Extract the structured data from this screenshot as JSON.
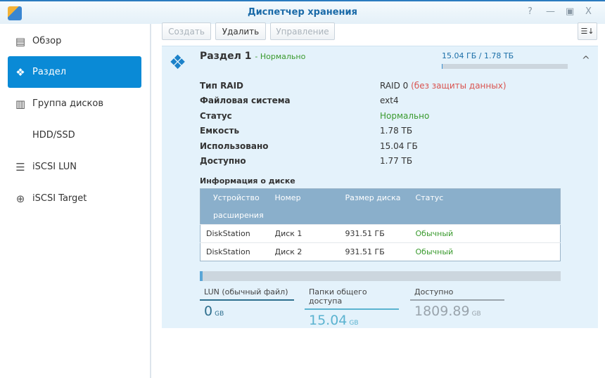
{
  "window": {
    "title": "Диспетчер хранения",
    "help": "?",
    "minimize": "—",
    "maximize": "▣",
    "close": "X"
  },
  "sidebar": {
    "items": [
      {
        "label": "Обзор",
        "icon": "overview-icon",
        "glyph": "▤"
      },
      {
        "label": "Раздел",
        "icon": "volume-icon",
        "glyph": "❖"
      },
      {
        "label": "Группа дисков",
        "icon": "disk-group-icon",
        "glyph": "▥"
      },
      {
        "label": "HDD/SSD",
        "icon": "hdd-icon",
        "glyph": ""
      },
      {
        "label": "iSCSI LUN",
        "icon": "iscsi-lun-icon",
        "glyph": "☰"
      },
      {
        "label": "iSCSI Target",
        "icon": "iscsi-target-icon",
        "glyph": "⊕"
      }
    ]
  },
  "toolbar": {
    "create": "Создать",
    "delete": "Удалить",
    "manage": "Управление",
    "sort_glyph": "☰↓"
  },
  "volume": {
    "name": "Раздел 1",
    "status": "- Нормально",
    "usage": "15.04 ГБ / 1.78 ТБ",
    "usage_percent": 0.8,
    "collapse": "^",
    "props": [
      {
        "k": "Тип RAID",
        "v": "RAID 0",
        "extra": "(без защиты данных)"
      },
      {
        "k": "Файловая система",
        "v": "ext4"
      },
      {
        "k": "Статус",
        "v": "Нормально"
      },
      {
        "k": "Емкость",
        "v": "1.78 ТБ"
      },
      {
        "k": "Использовано",
        "v": "15.04 ГБ"
      },
      {
        "k": "Доступно",
        "v": "1.77 ТБ"
      }
    ],
    "disk_info_title": "Информация о диске",
    "disk_table": {
      "headers": [
        "Устройство расширения",
        "Номер",
        "Размер диска",
        "Статус"
      ],
      "rows": [
        [
          "DiskStation",
          "Диск 1",
          "931.51 ГБ",
          "Обычный"
        ],
        [
          "DiskStation",
          "Диск 2",
          "931.51 ГБ",
          "Обычный"
        ]
      ]
    },
    "bottom_usage_percent": 0.8,
    "stats": [
      {
        "label": "LUN (обычный файл)",
        "value": "0",
        "unit": "GB",
        "color": "#2e6f8e"
      },
      {
        "label": "Папки общего доступа",
        "value": "15.04",
        "unit": "GB",
        "color": "#5bb3d0"
      },
      {
        "label": "Доступно",
        "value": "1809.89",
        "unit": "GB",
        "color": "#9aa4ac"
      }
    ]
  },
  "colors": {
    "accent": "#0a8ad6",
    "ok": "#3a9a2e",
    "warn": "#d9534f"
  }
}
